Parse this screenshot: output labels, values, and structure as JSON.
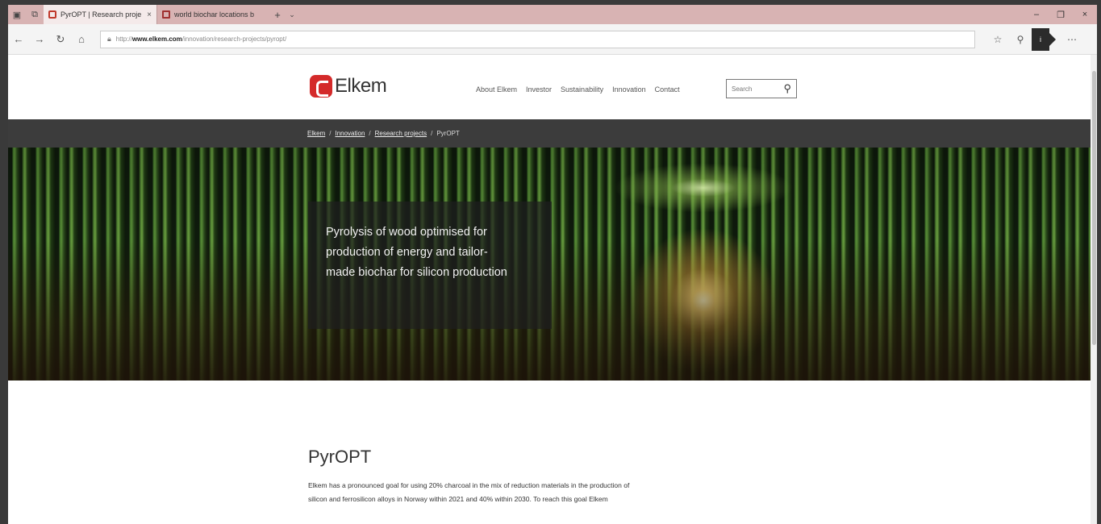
{
  "browser": {
    "tabs": [
      {
        "label": "PyrOPT | Research proje",
        "active": true
      },
      {
        "label": "world biochar locations b",
        "active": false
      }
    ],
    "new_tab": "+",
    "tab_dropdown": "⌄",
    "close_tab": "×",
    "window_controls": {
      "minimize": "–",
      "maximize": "❐",
      "close": "×"
    },
    "nav": {
      "back": "←",
      "forward": "→",
      "reload": "↻",
      "home": "⌂"
    },
    "url": {
      "prefix": "http://",
      "domain": "www.elkem.com",
      "path": "/innovation/research-projects/pyropt/"
    },
    "right_icons": {
      "favorite": "☆",
      "extensions": "⚲",
      "profile": "i",
      "more": "⋯"
    }
  },
  "site": {
    "logo_text": "Elkem",
    "nav": [
      "About Elkem",
      "Investor",
      "Sustainability",
      "Innovation",
      "Contact"
    ],
    "search_placeholder": "Search",
    "breadcrumb": [
      "Elkem",
      "Innovation",
      "Research projects",
      "PyrOPT"
    ],
    "hero_text": "Pyrolysis of wood optimised for production of energy and tailor-made biochar for silicon production",
    "page_title": "PyrOPT",
    "intro": "Elkem has a pronounced goal for using 20% charcoal in the mix of reduction materials in the production of silicon and ferrosilicon alloys in Norway within 2021 and 40% within 2030. To reach this goal Elkem"
  },
  "colors": {
    "brand_red": "#d42a2a",
    "tabbar": "#d8b3b3",
    "crumbbar": "#3c3c3c"
  }
}
